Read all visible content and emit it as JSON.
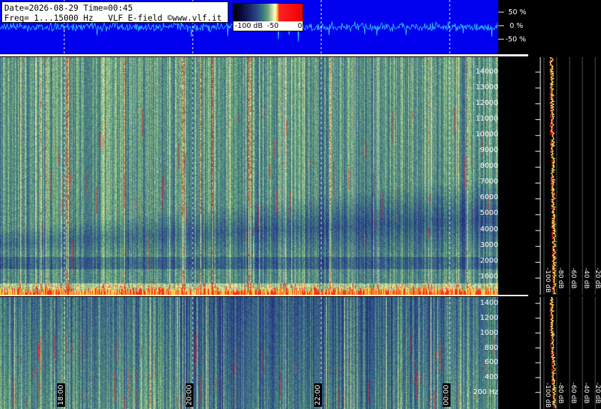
{
  "info": {
    "line1": "Date=2026-08-29 Time=00:45",
    "line2": "Freq= 1...15000 Hz   VLF E-field ©www.vlf.it"
  },
  "colorbar": {
    "labels": [
      "-100 dB",
      "-50",
      "0"
    ]
  },
  "waveform_scale": [
    "50 %",
    "0 %",
    "-50 %"
  ],
  "top_freq_ticks": [
    "14000",
    "13000",
    "12000",
    "11000",
    "10000",
    "9000",
    "8000",
    "7000",
    "6000",
    "5000",
    "4000",
    "3000",
    "2000",
    "1000"
  ],
  "bottom_freq_ticks": [
    "1400",
    "1200",
    "1000",
    "800",
    "600",
    "400",
    "200 Hz"
  ],
  "top_db_labels": [
    "-100 dB",
    "-80 dB",
    "-60 dB",
    "-40 dB",
    "-20 dB"
  ],
  "bottom_db_labels": [
    "-100 dB",
    "-80 dB",
    "-60 dB",
    "-40 dB",
    "-20 dB"
  ],
  "time_labels": [
    "18:00",
    "20:00",
    "22:00",
    "00:00"
  ],
  "colors": {
    "wave_bg": "#0000ee",
    "wave_trace": "#33ccff",
    "spectrum_red": "#ff2222",
    "spectrum_yellow": "#ffff66"
  }
}
